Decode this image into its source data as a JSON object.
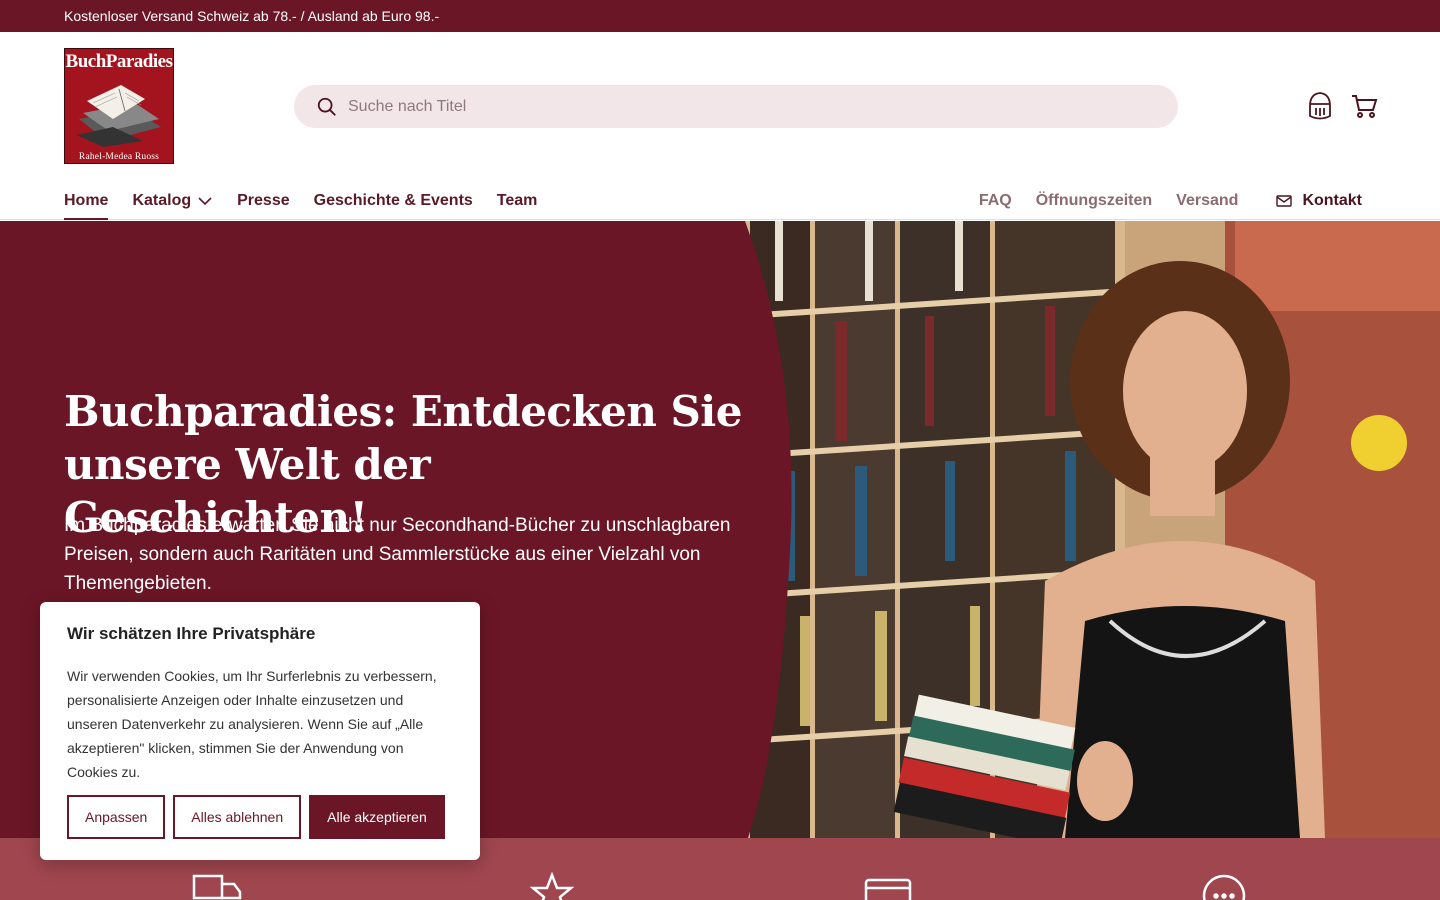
{
  "announcement": "Kostenloser Versand Schweiz ab 78.- / Ausland ab Euro 98.-",
  "logo": {
    "title": "BuchParadies",
    "subtitle": "Rahel-Medea Ruoss"
  },
  "search": {
    "placeholder": "Suche nach Titel"
  },
  "header_icons": [
    "account-icon",
    "cart-icon"
  ],
  "nav": {
    "items": [
      {
        "label": "Home",
        "active": true
      },
      {
        "label": "Katalog",
        "has_dropdown": true
      },
      {
        "label": "Presse"
      },
      {
        "label": "Geschichte & Events"
      },
      {
        "label": "Team"
      }
    ],
    "secondary": [
      "FAQ",
      "Öffnungszeiten",
      "Versand"
    ],
    "contact_label": "Kontakt"
  },
  "hero": {
    "title": "Buchparadies: Entdecken Sie unsere Welt der Geschichten!",
    "text": "Im Buchparadies erwarten Sie nicht nur Secondhand-Bücher zu unschlagbaren Preisen, sondern auch Raritäten und Sammlerstücke aus einer Vielzahl von Themengebieten."
  },
  "usp_icons": [
    "truck-icon",
    "star-icon",
    "credit-card-icon",
    "chat-icon"
  ],
  "cookie": {
    "title": "Wir schätzen Ihre Privatsphäre",
    "text": "Wir verwenden Cookies, um Ihr Surferlebnis zu verbessern, personalisierte Anzeigen oder Inhalte einzusetzen und unseren Datenverkehr zu analysieren. Wenn Sie auf „Alle akzeptieren\" klicken, stimmen Sie der Anwendung von Cookies zu.",
    "customize": "Anpassen",
    "reject": "Alles ablehnen",
    "accept": "Alle akzeptieren"
  },
  "colors": {
    "brand": "#6b1626",
    "usp_bar": "#a0464f",
    "search_bg": "#f2e6e8"
  }
}
